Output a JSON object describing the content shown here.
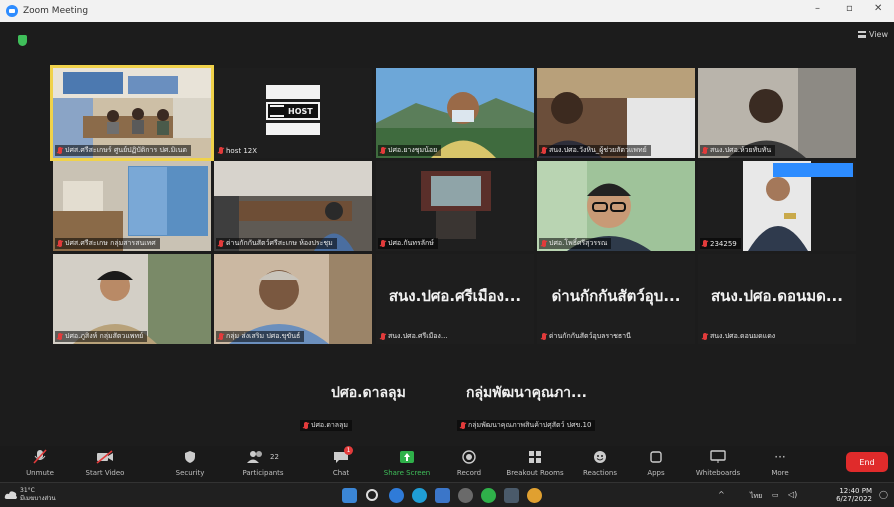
{
  "window": {
    "title": "Zoom Meeting",
    "minimize": "–",
    "restore": "▫",
    "close": "✕"
  },
  "view_label": "View",
  "tiles": [
    {
      "id": "t1",
      "name": "ปศส.ศรีสะเกษร์ ศูนย์ปฏิบัติการ ปศ.มิเนต",
      "active": true
    },
    {
      "id": "t2",
      "name": "host 12X",
      "host_label": "HOST"
    },
    {
      "id": "t3",
      "name": "ปศอ.ยางชุมน้อย"
    },
    {
      "id": "t4",
      "name": "สนง.ปศอ.วังหิน_ผู้ช่วยสัตวแพทย์"
    },
    {
      "id": "t5",
      "name": "สนง.ปศอ.ห้วยทับทัน"
    },
    {
      "id": "t6",
      "name": "ปศส.ศรีสะเกษ กลุ่มสารสนเทศ"
    },
    {
      "id": "t7",
      "name": "ด่านกักกันสัตว์ศรีสะเกษ ห้องประชุม"
    },
    {
      "id": "t8",
      "name": "ปศอ.กันทรลักษ์"
    },
    {
      "id": "t9",
      "name": "ปศอ.โพธิ์ศรีสุวรรณ"
    },
    {
      "id": "t10",
      "name": "234259"
    },
    {
      "id": "t11",
      "name": "ปศอ.ภูสิงห์ กลุ่มสัตวแพทย์"
    },
    {
      "id": "t12",
      "name": "กลุ่ม ส่งเสริม ปศอ.ขุขันธ์"
    },
    {
      "id": "t13",
      "name": "สนง.ปศอ.ศรีเมือง...",
      "label": "สนง.ปศอ.ศรีเมือง..."
    },
    {
      "id": "t14",
      "name": "ด่านกักกันสัตว์อุบลราชธานี",
      "label": "ด่านกักกันสัตว์อุบ..."
    },
    {
      "id": "t15",
      "name": "สนง.ปศอ.ดอนมดแดง",
      "label": "สนง.ปศอ.ดอนมด..."
    }
  ],
  "bottom_participants": [
    {
      "label": "ปศอ.ดาลลุม",
      "tag": "ปศอ.ดาลลุม"
    },
    {
      "label": "กลุ่มพัฒนาคุณภา...",
      "tag": "กลุ่มพัฒนาคุณภาพสินค้าปศุสัตว์ ปศข.10"
    }
  ],
  "toolbar": {
    "unmute": "Unmute",
    "start_video": "Start Video",
    "security": "Security",
    "participants": "Participants",
    "participants_count": "22",
    "chat": "Chat",
    "chat_badge": "1",
    "share_screen": "Share Screen",
    "record": "Record",
    "breakout": "Breakout Rooms",
    "reactions": "Reactions",
    "apps": "Apps",
    "whiteboards": "Whiteboards",
    "more": "More",
    "end": "End"
  },
  "taskbar": {
    "temp": "31°C",
    "weather": "มีเมฆบางส่วน",
    "lang": "ไทย",
    "time": "12:40 PM",
    "date": "6/27/2022"
  }
}
